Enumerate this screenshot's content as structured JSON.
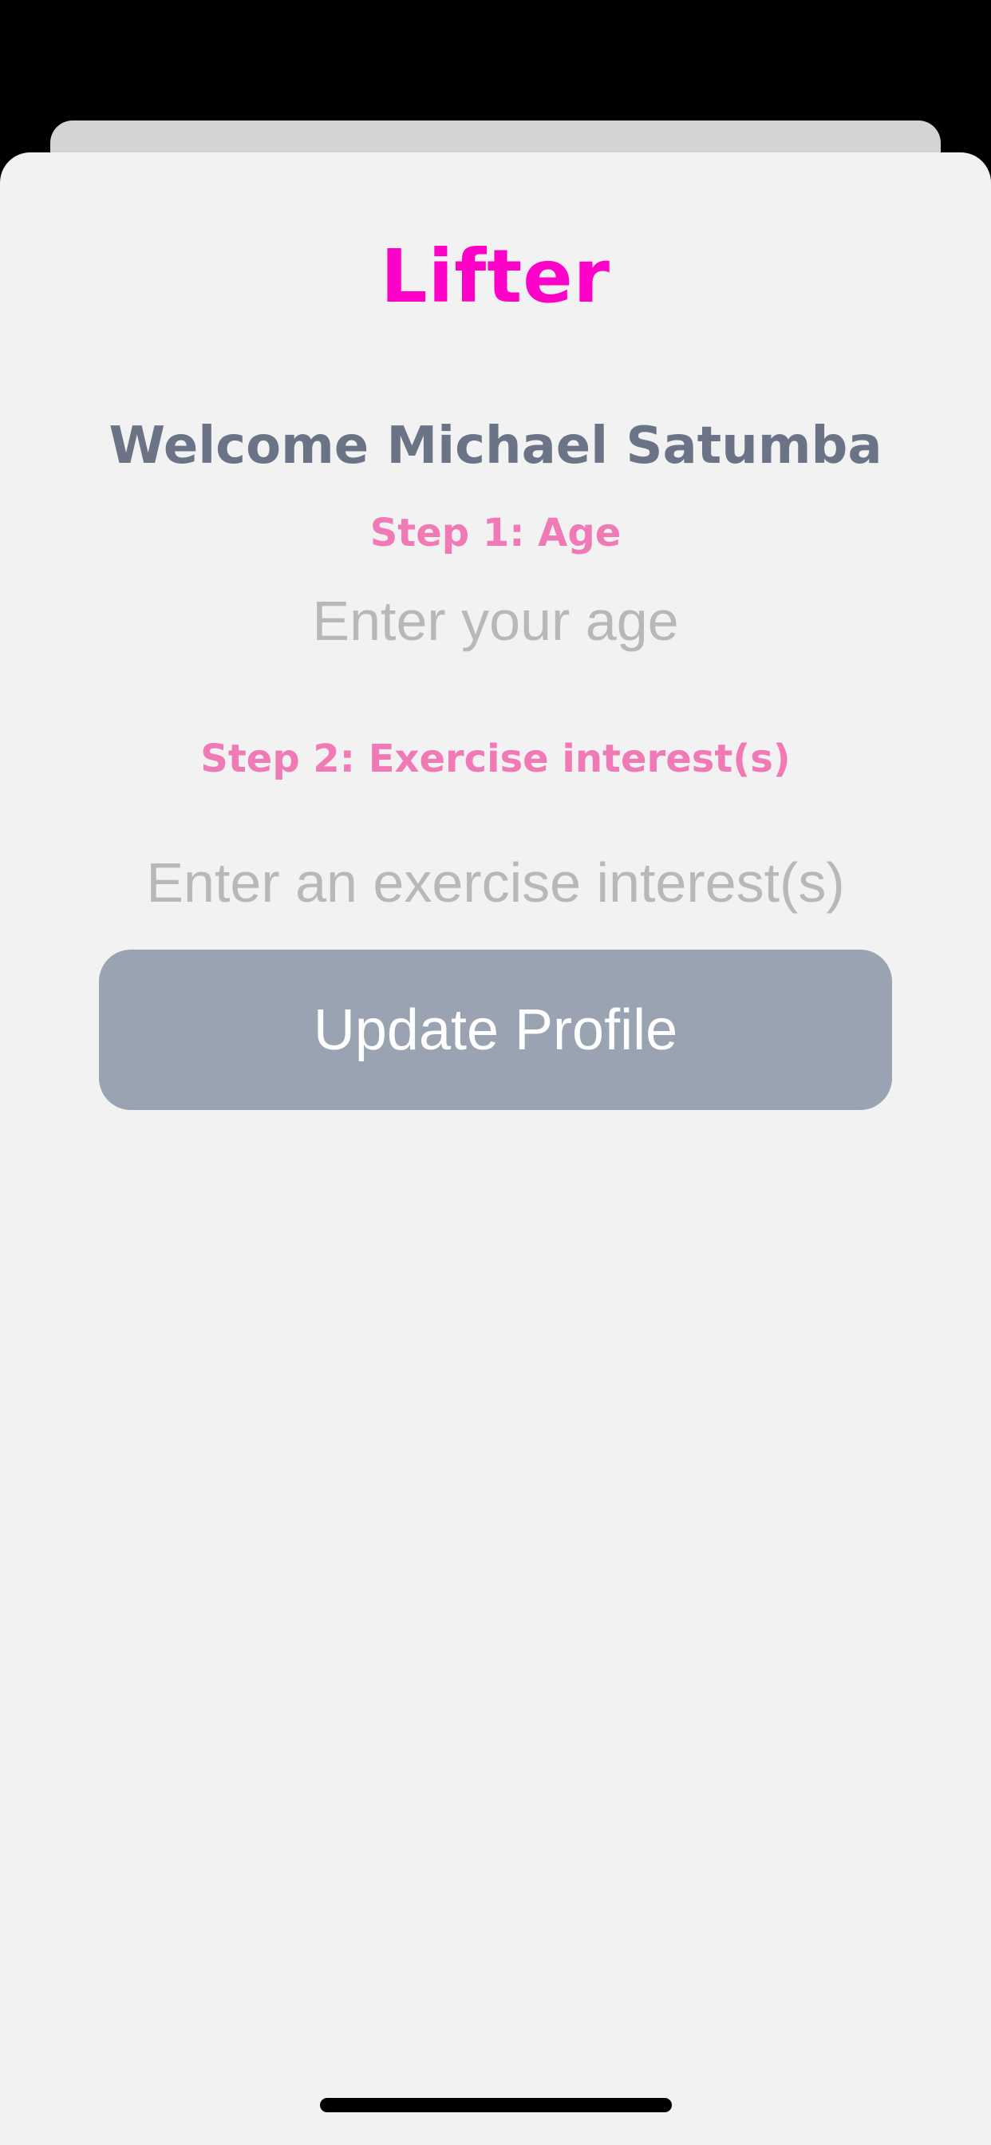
{
  "app": {
    "logo_text": "Lifter"
  },
  "onboarding": {
    "welcome_text": "Welcome Michael Satumba",
    "step1_label": "Step 1: Age",
    "age_placeholder": "Enter your age",
    "age_value": "",
    "step2_label": "Step 2: Exercise interest(s)",
    "interest_placeholder": "Enter an exercise interest(s)",
    "interest_value": "",
    "update_button_label": "Update Profile"
  },
  "colors": {
    "brand": "#ff00c8",
    "step_label": "#f07ab6",
    "welcome_text": "#6b7386",
    "button_bg": "#9aa3b1",
    "sheet_bg": "#f2f2f2"
  }
}
